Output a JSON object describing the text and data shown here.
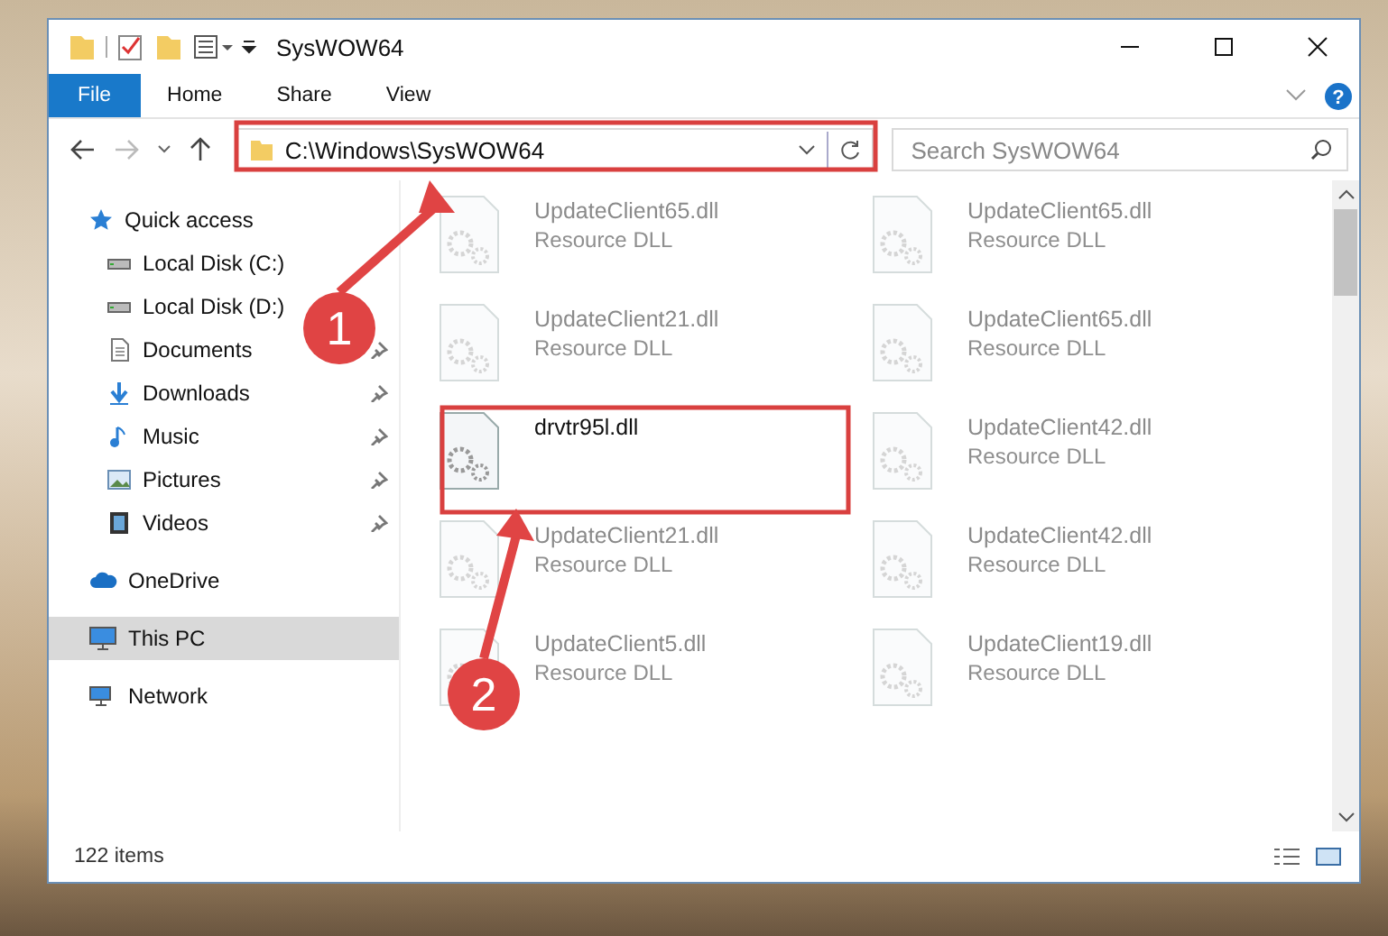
{
  "window": {
    "title": "SysWOW64"
  },
  "ribbon_tabs": [
    {
      "label": "File",
      "selected": true
    },
    {
      "label": "Home",
      "selected": false
    },
    {
      "label": "Share",
      "selected": false
    },
    {
      "label": "View",
      "selected": false
    }
  ],
  "address_bar": {
    "path": "C:\\Windows\\SysWOW64"
  },
  "search": {
    "placeholder": "Search SysWOW64"
  },
  "sidebar": {
    "items": [
      {
        "label": "Quick access",
        "pinned": false,
        "selected": false
      },
      {
        "label": "Local Disk (C:)",
        "pinned": false,
        "selected": false
      },
      {
        "label": "Local Disk (D:)",
        "pinned": false,
        "selected": false
      },
      {
        "label": "Documents",
        "pinned": true,
        "selected": false
      },
      {
        "label": "Downloads",
        "pinned": true,
        "selected": false
      },
      {
        "label": "Music",
        "pinned": true,
        "selected": false
      },
      {
        "label": "Pictures",
        "pinned": true,
        "selected": false
      },
      {
        "label": "Videos",
        "pinned": true,
        "selected": false
      },
      {
        "label": "OneDrive",
        "pinned": false,
        "selected": false
      },
      {
        "label": "This PC",
        "pinned": false,
        "selected": true
      },
      {
        "label": "Network",
        "pinned": false,
        "selected": false
      }
    ]
  },
  "help": {
    "label": "?"
  },
  "files": [
    {
      "name": "UpdateClient65.dll",
      "type": "Resource DLL",
      "faded": true,
      "highlighted": false
    },
    {
      "name": "UpdateClient65.dll",
      "type": "Resource DLL",
      "faded": true,
      "highlighted": false
    },
    {
      "name": "UpdateClient21.dll",
      "type": "Resource DLL",
      "faded": true,
      "highlighted": false
    },
    {
      "name": "UpdateClient65.dll",
      "type": "Resource DLL",
      "faded": true,
      "highlighted": false
    },
    {
      "name": "drvtr95l.dll",
      "faded": false,
      "highlighted": true
    },
    {
      "name": "UpdateClient42.dll",
      "type": "Resource DLL",
      "faded": true,
      "highlighted": false
    },
    {
      "name": "UpdateClient21.dll",
      "type": "Resource DLL",
      "faded": true,
      "highlighted": false
    },
    {
      "name": "UpdateClient42.dll",
      "type": "Resource DLL",
      "faded": true,
      "highlighted": false
    },
    {
      "name": "UpdateClient5.dll",
      "type": "Resource DLL",
      "faded": true,
      "highlighted": false
    },
    {
      "name": "UpdateClient19.dll",
      "type": "Resource DLL",
      "faded": true,
      "highlighted": false
    }
  ],
  "status_bar": {
    "item_count": "122 items"
  },
  "annotations": [
    {
      "label": "1"
    },
    {
      "label": "2"
    }
  ]
}
